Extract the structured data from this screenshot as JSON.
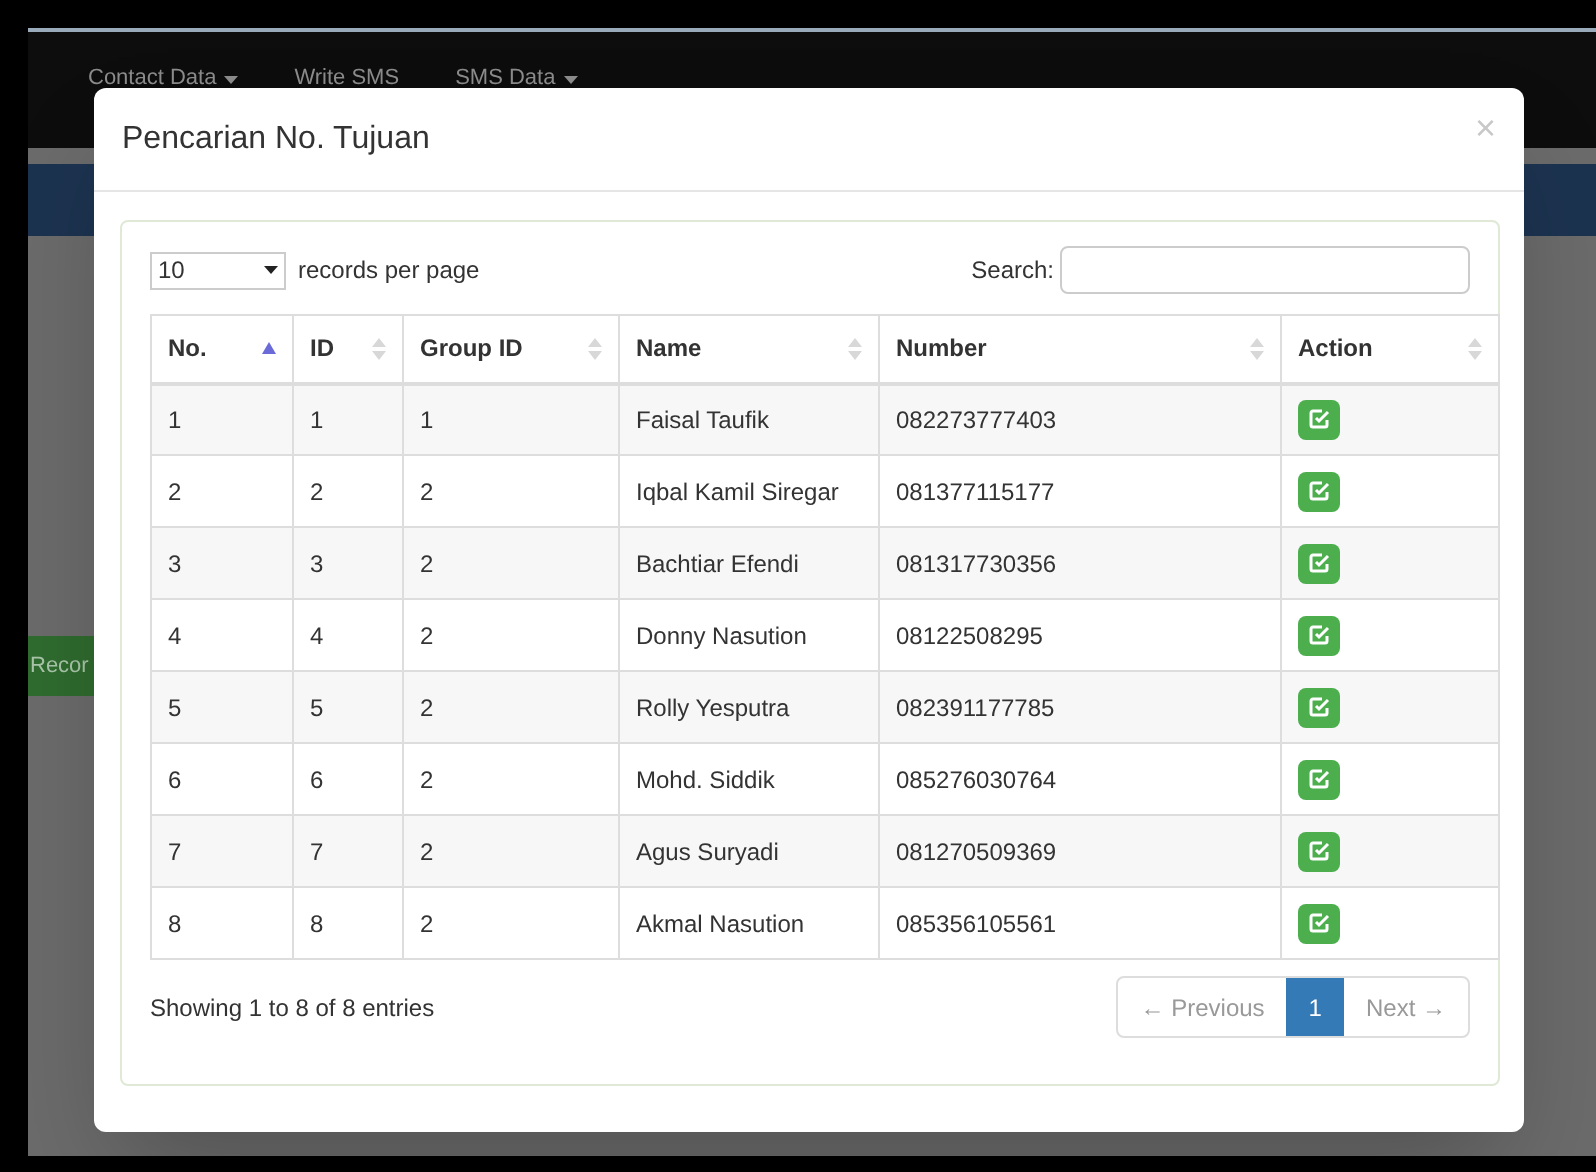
{
  "navbar": {
    "items": [
      {
        "label": "Contact Data",
        "dropdown": true
      },
      {
        "label": "Write SMS",
        "dropdown": false
      },
      {
        "label": "SMS Data",
        "dropdown": true
      }
    ]
  },
  "background": {
    "button": "Recor"
  },
  "modal": {
    "title": "Pencarian No. Tujuan",
    "close": "×",
    "length_select": {
      "value": "10"
    },
    "length_label": "records per page",
    "search_label": "Search:",
    "table": {
      "columns": [
        {
          "label": "No.",
          "sorted": true
        },
        {
          "label": "ID",
          "sorted": false
        },
        {
          "label": "Group ID",
          "sorted": false
        },
        {
          "label": "Name",
          "sorted": false
        },
        {
          "label": "Number",
          "sorted": false
        },
        {
          "label": "Action",
          "sorted": false
        }
      ],
      "rows": [
        [
          "1",
          "1",
          "1",
          "Faisal Taufik",
          "082273777403"
        ],
        [
          "2",
          "2",
          "2",
          "Iqbal Kamil Siregar",
          "081377115177"
        ],
        [
          "3",
          "3",
          "2",
          "Bachtiar Efendi",
          "081317730356"
        ],
        [
          "4",
          "4",
          "2",
          "Donny Nasution",
          "08122508295"
        ],
        [
          "5",
          "5",
          "2",
          "Rolly Yesputra",
          "082391177785"
        ],
        [
          "6",
          "6",
          "2",
          "Mohd. Siddik",
          "085276030764"
        ],
        [
          "7",
          "7",
          "2",
          "Agus Suryadi",
          "081270509369"
        ],
        [
          "8",
          "8",
          "2",
          "Akmal Nasution",
          "085356105561"
        ]
      ]
    },
    "info": "Showing 1 to 8 of 8 entries",
    "pagination": {
      "previous": {
        "label": "← Previous",
        "disabled": true
      },
      "pages": [
        {
          "label": "1",
          "selected": true
        }
      ],
      "next": {
        "label": "Next →",
        "disabled": true
      }
    }
  }
}
